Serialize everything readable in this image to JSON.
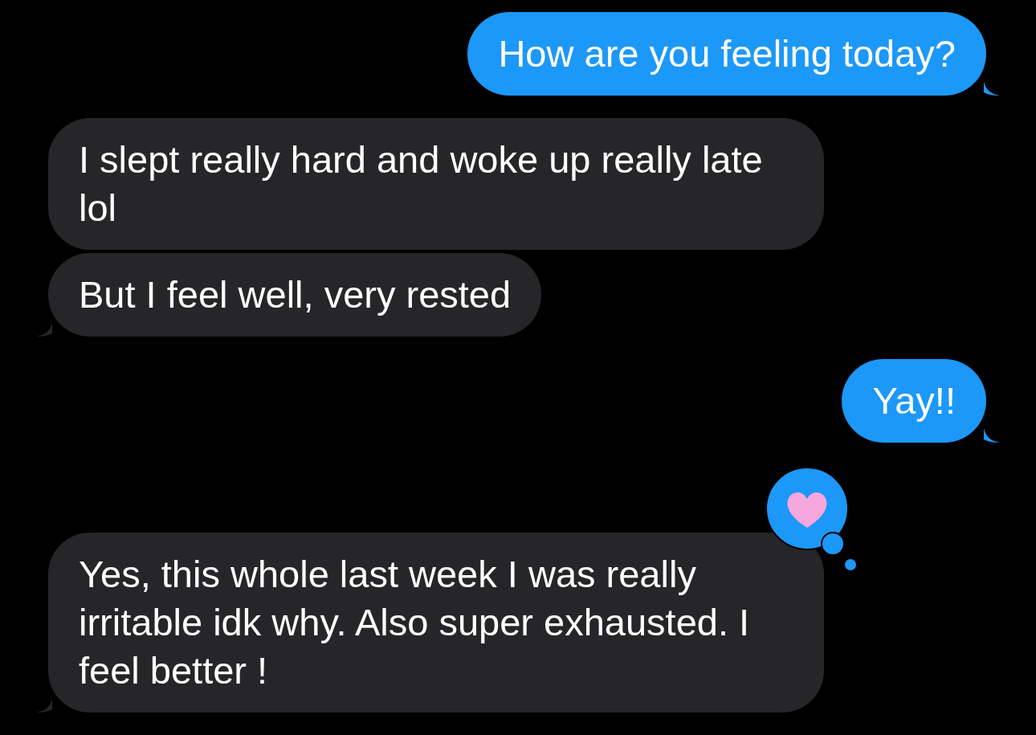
{
  "messages": [
    {
      "kind": "sent",
      "text": "How are you feeling today?",
      "tail": true
    },
    {
      "kind": "received",
      "text": "I slept really hard and woke up really late lol",
      "tail": false
    },
    {
      "kind": "received",
      "text": "But I feel well, very rested",
      "tail": true
    },
    {
      "kind": "sent",
      "text": "Yay!!",
      "tail": true
    },
    {
      "kind": "received",
      "text": "Yes, this whole last week I was really irritable idk why. Also super exhausted. I feel better !",
      "tail": true,
      "reaction": {
        "kind": "heart"
      }
    }
  ]
}
